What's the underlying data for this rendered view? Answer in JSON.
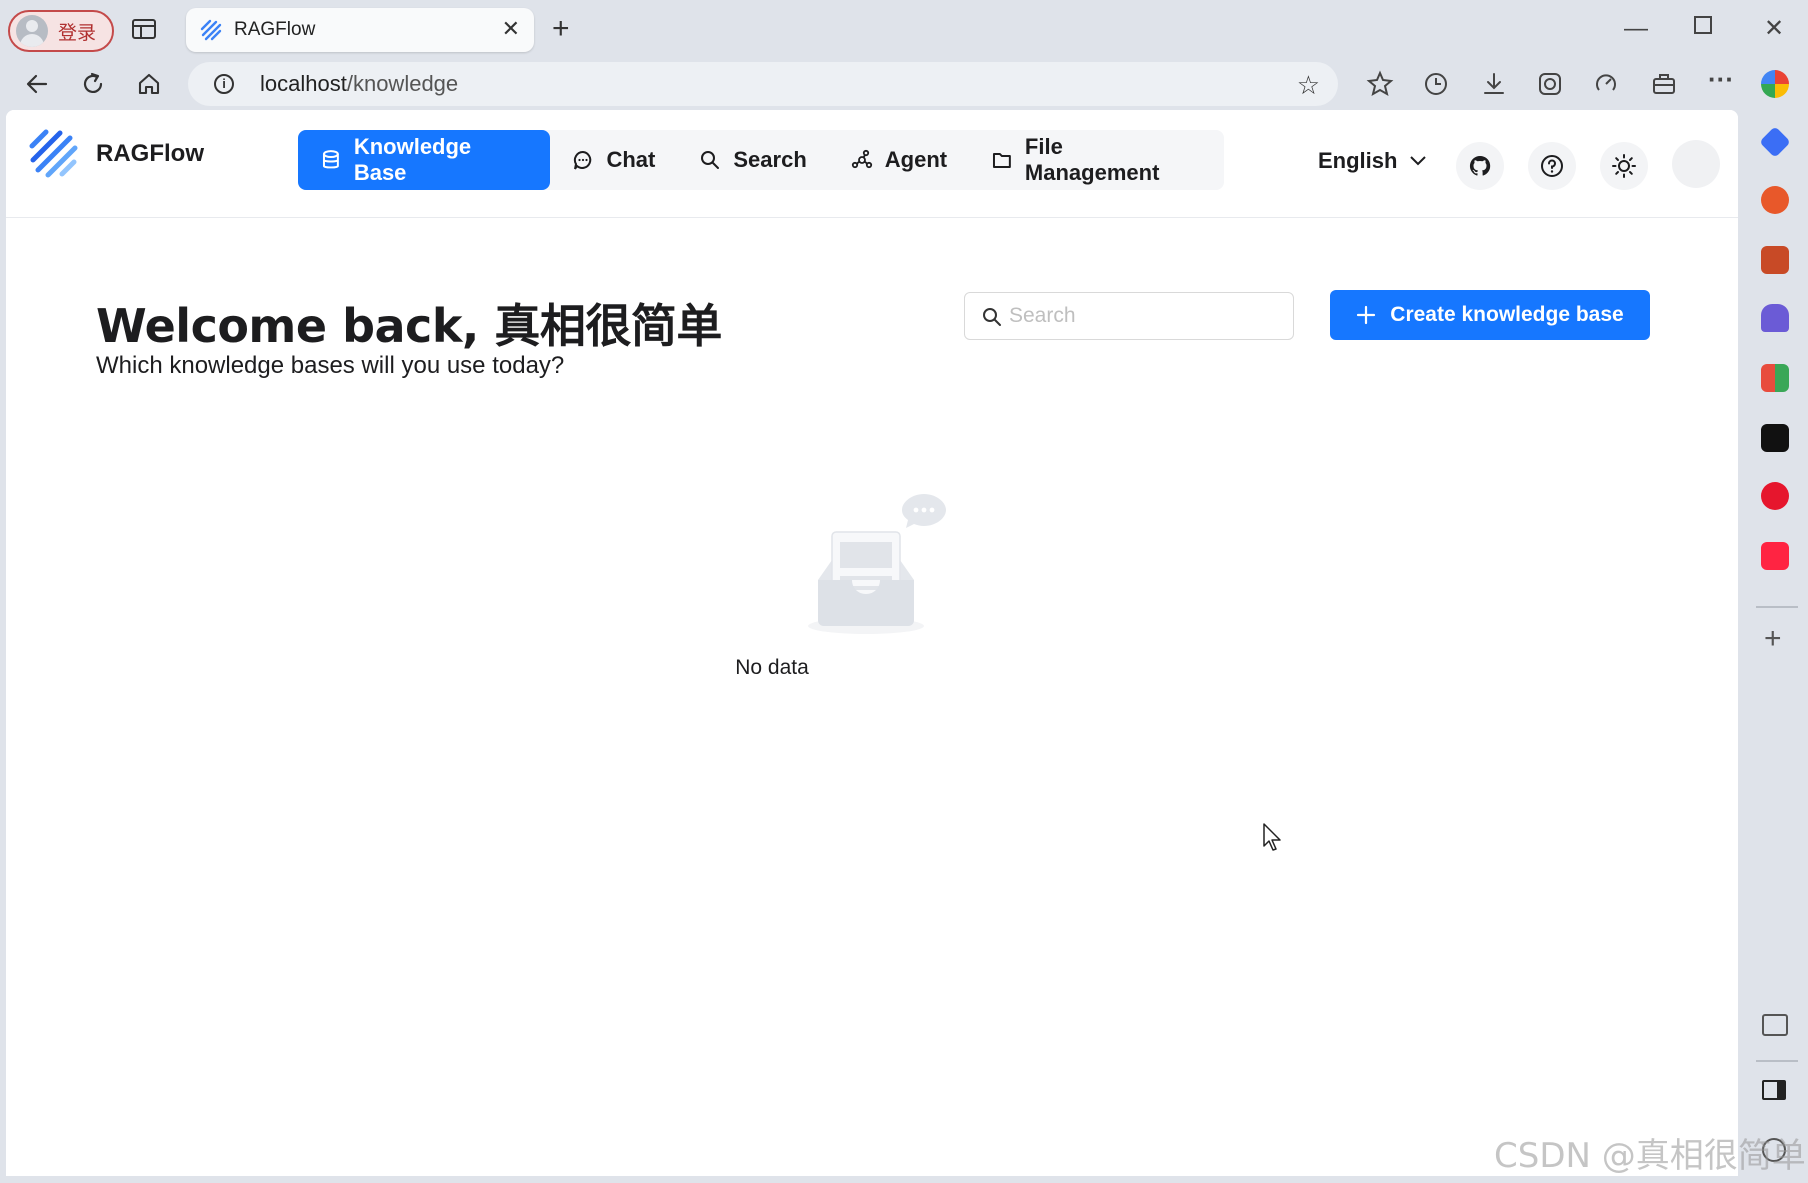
{
  "browser": {
    "profile_label": "登录",
    "tab_title": "RAGFlow",
    "url_host": "localhost",
    "url_path": "/knowledge"
  },
  "app": {
    "brand": "RAGFlow",
    "nav": [
      {
        "label": "Knowledge Base",
        "icon": "database-icon",
        "active": true
      },
      {
        "label": "Chat",
        "icon": "chat-bubble-icon",
        "active": false
      },
      {
        "label": "Search",
        "icon": "search-icon",
        "active": false
      },
      {
        "label": "Agent",
        "icon": "agent-graph-icon",
        "active": false
      },
      {
        "label": "File Management",
        "icon": "folder-icon",
        "active": false
      }
    ],
    "language": "English"
  },
  "main": {
    "welcome_title": "Welcome back, 真相很简单",
    "welcome_subtitle": "Which knowledge bases will you use today?",
    "search_placeholder": "Search",
    "create_button_label": "Create knowledge base",
    "empty_text": "No data"
  },
  "watermark": "CSDN @真相很简单",
  "colors": {
    "primary": "#1677ff",
    "chrome_bg": "#dfe3ea",
    "page_bg": "#ffffff"
  }
}
